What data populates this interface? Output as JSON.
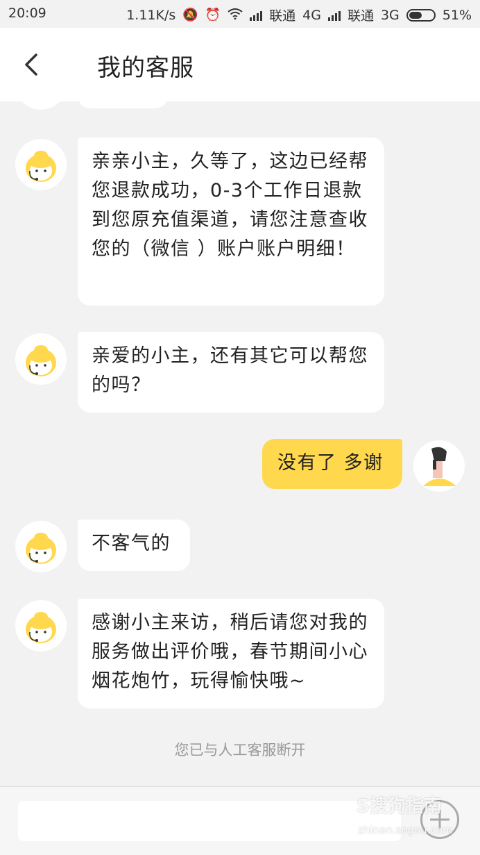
{
  "status_bar": {
    "time": "20:09",
    "speed": "1.11K/s",
    "carrier1": "联通",
    "network1": "4G",
    "carrier2": "联通",
    "network2": "3G",
    "battery": "51%"
  },
  "header": {
    "title": "我的客服",
    "back_icon": "chevron-left-icon"
  },
  "messages": [
    {
      "from": "agent",
      "text": "亲亲小主，久等了，这边已经帮您退款成功，0-3个工作日退款到您原充值渠道，请您注意查收您的（微信 ）账户账户明细！"
    },
    {
      "from": "agent",
      "text": "亲爱的小主，还有其它可以帮您的吗？"
    },
    {
      "from": "user",
      "text": "没有了 多谢"
    },
    {
      "from": "agent",
      "text": "不客气的"
    },
    {
      "from": "agent",
      "text": "感谢小主来访，稍后请您对我的服务做出评价哦，春节期间小心烟花炮竹，玩得愉快哦~"
    }
  ],
  "system_message": "您已与人工客服断开",
  "input": {
    "placeholder": "",
    "value": ""
  },
  "watermark": {
    "main": "S搜狗指南",
    "sub": "zhinan.sogou.com"
  },
  "colors": {
    "accent": "#ffd84e",
    "background": "#f2f2f2"
  }
}
